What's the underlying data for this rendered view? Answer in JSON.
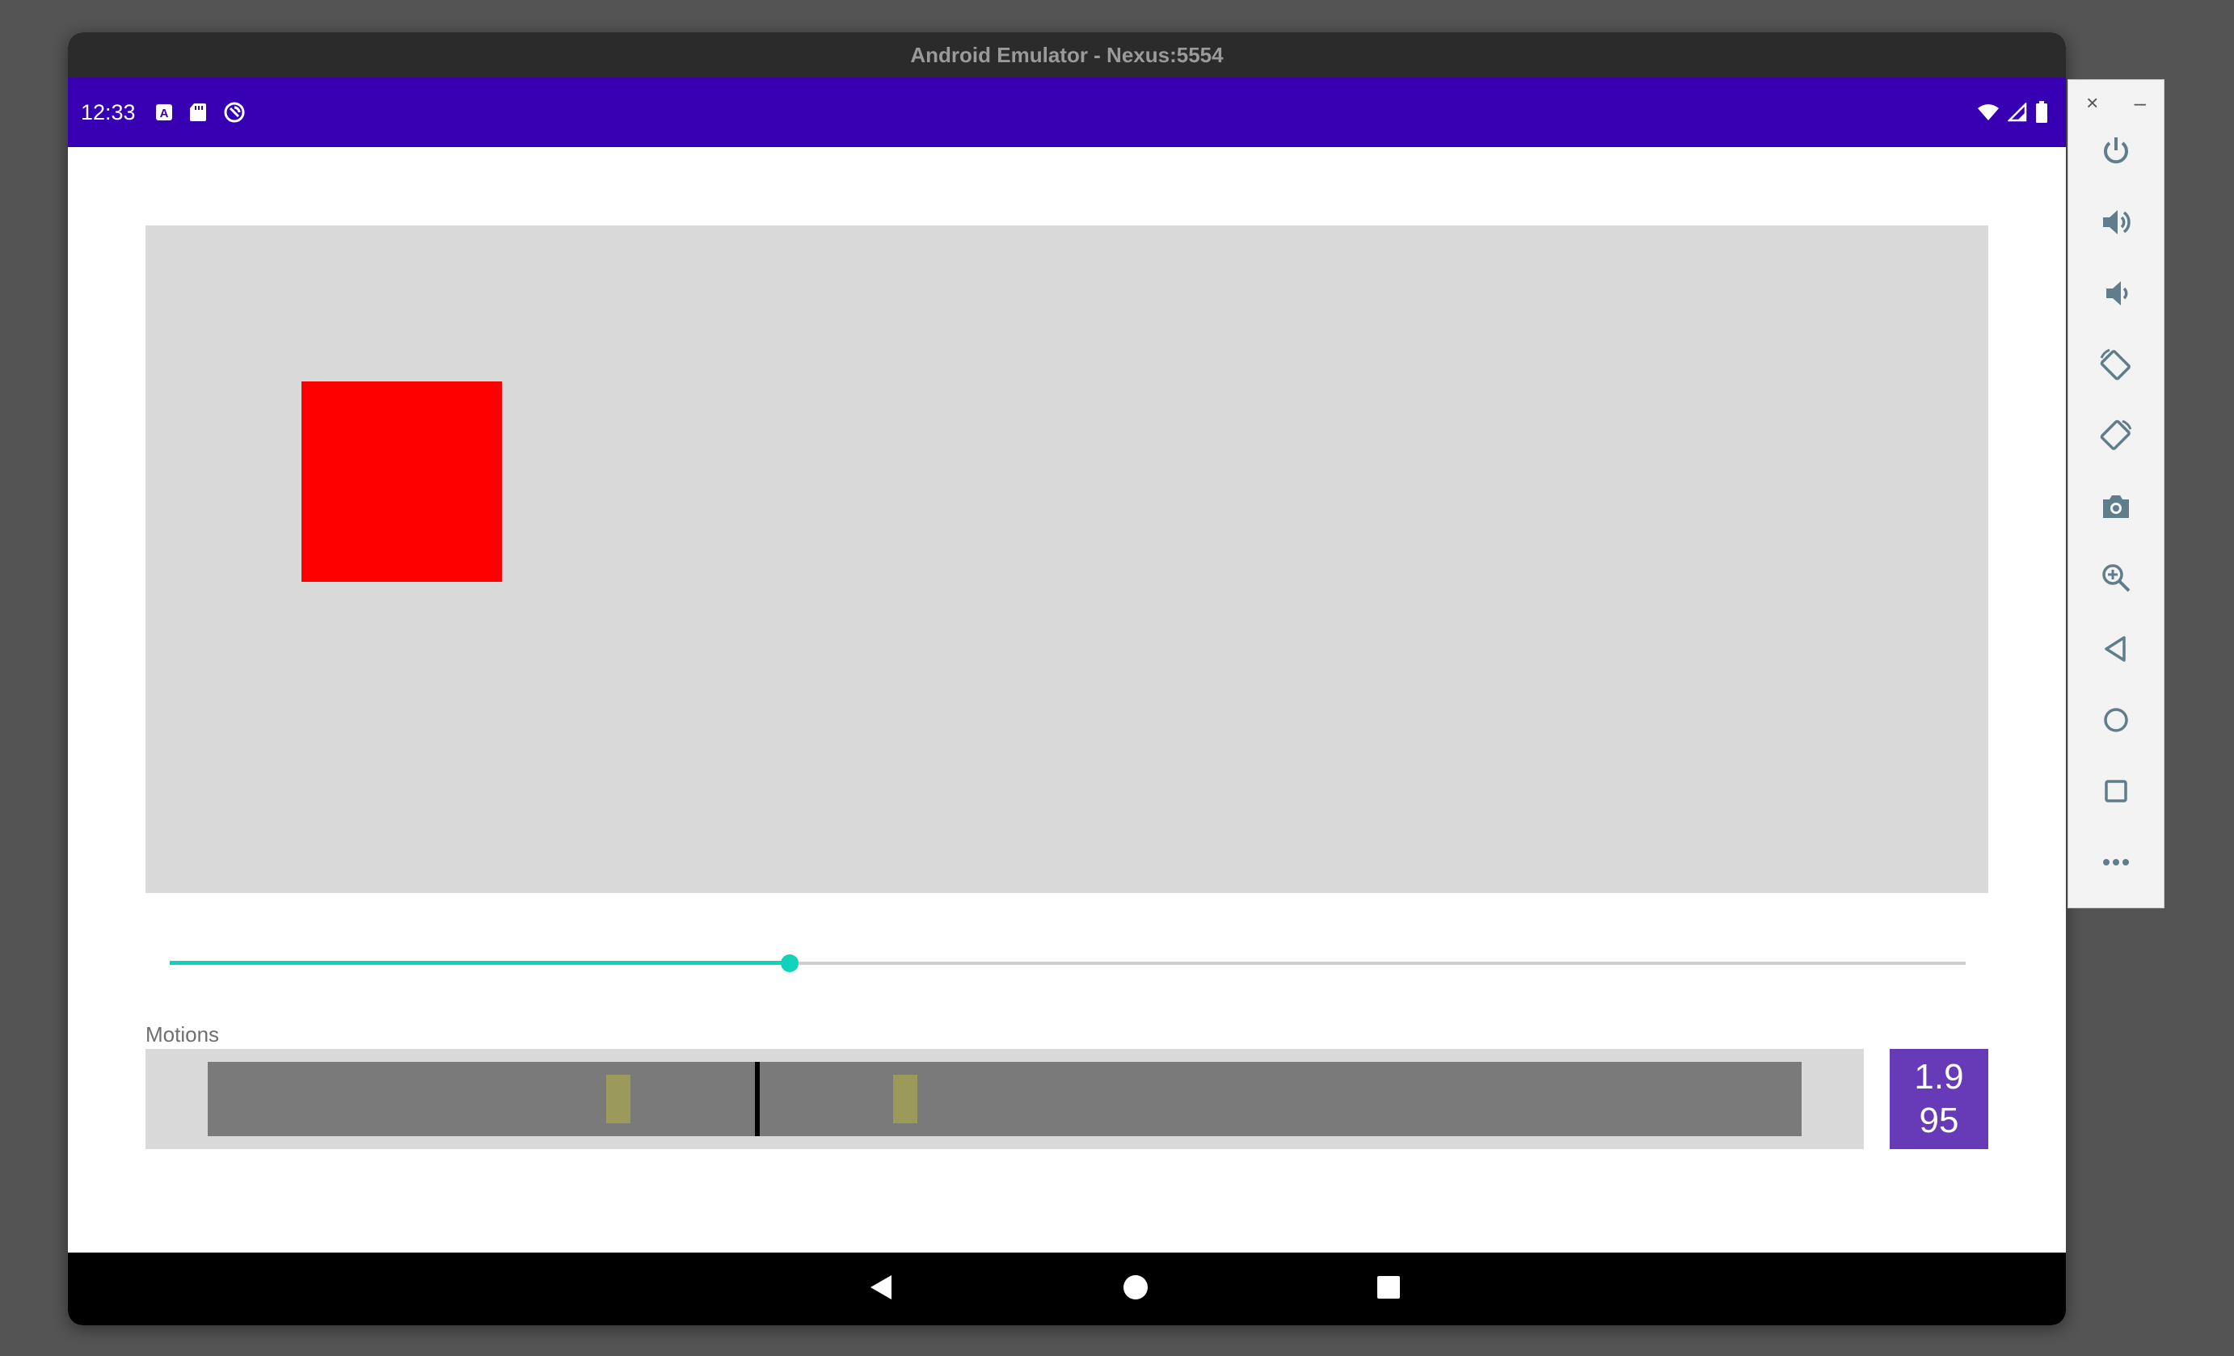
{
  "window": {
    "title": "Android Emulator - Nexus:5554"
  },
  "status_bar": {
    "time": "12:33",
    "left_icons": [
      "a-notification-icon",
      "sd-card-icon",
      "sync-icon"
    ],
    "right_icons": [
      "wifi-icon",
      "cell-signal-icon",
      "battery-icon"
    ],
    "color": "#3700b3"
  },
  "canvas": {
    "background": "#d9d9d9",
    "box_color": "#ff0000"
  },
  "slider": {
    "progress": 0.345,
    "accent": "#11d3bc"
  },
  "motions": {
    "label": "Motions",
    "keyframes": [
      0.25,
      0.43
    ],
    "playhead": 0.345,
    "value_line1": "1.9",
    "value_line2": "95"
  },
  "nav_bar": {
    "icons": [
      "back-icon",
      "home-icon",
      "recents-icon"
    ]
  },
  "side_panel": {
    "close_label": "×",
    "minimize_label": "–",
    "buttons": [
      "power-icon",
      "volume-up-icon",
      "volume-down-icon",
      "rotate-left-icon",
      "rotate-right-icon",
      "camera-icon",
      "zoom-icon",
      "back-icon",
      "home-icon",
      "overview-icon",
      "more-icon"
    ]
  }
}
